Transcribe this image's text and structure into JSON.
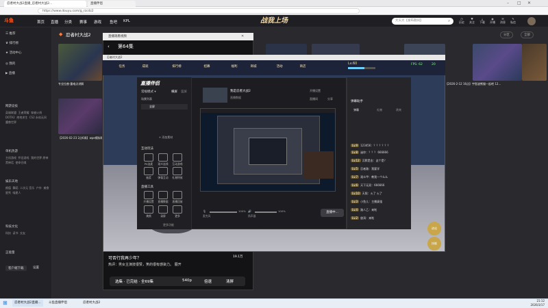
{
  "browser": {
    "tabs": [
      {
        "label": "忍者村大战2直播_忍者村大战2..."
      },
      {
        "label": "直播伴侣"
      }
    ],
    "url": "https://www.douyu.com/g_rzcdz2"
  },
  "site": {
    "logo": "斗鱼",
    "nav": [
      "首页",
      "直播",
      "分类",
      "赛事",
      "游戏",
      "鱼吧",
      "KPL"
    ],
    "banner_title": "战我上场",
    "search_placeholder": "大头大【发布期间】",
    "header_icons": [
      "历史",
      "关注",
      "下载",
      "开播",
      "消息",
      "私信"
    ]
  },
  "sidebar": {
    "items": [
      {
        "label": "推荐"
      },
      {
        "label": "排行榜"
      },
      {
        "label": "活动中心"
      },
      {
        "label": "我的"
      },
      {
        "label": "直播"
      }
    ],
    "sections": [
      {
        "title": "网游竞技",
        "subs": [
          "英雄联盟",
          "王者荣耀",
          "穿越火线",
          "DOTA2",
          "绝地求生",
          "CS2",
          "永劫无间",
          "魔兽世界"
        ]
      },
      {
        "title": "单机热游",
        "subs": [
          "主机游戏",
          "怀旧游戏",
          "我的世界",
          "原神",
          "黑神话",
          "使命召唤"
        ]
      },
      {
        "title": "娱乐天地",
        "subs": [
          "颜值",
          "舞蹈",
          "二次元",
          "音乐",
          "户外",
          "美食",
          "星秀",
          "喵星人"
        ]
      },
      {
        "title": "科技文化",
        "subs": [
          "科技",
          "读书",
          "交友"
        ]
      },
      {
        "title": "正能量",
        "subs": []
      }
    ],
    "bottom_buttons": [
      "客户端下载",
      "设置"
    ]
  },
  "main": {
    "heading": "忍者村大战2",
    "thumb_captions": [
      "【2026-2-12 16点】宇智波熊猫一起吧 12...",
      "【2026-02-23 2点6周】wpe模拟嗯嗯"
    ],
    "follow_button": "全部",
    "category_button": "分区"
  },
  "video_window": {
    "title": "直播观看视频",
    "episode": "第64集",
    "subtitle_line": "可否行我再少年？",
    "danmaku_line": "热评：男女主演技很赞，笑的很有感染力。",
    "expand": "展开",
    "views": "19.1万",
    "episode_bar": {
      "label": "选集 · 已完结 · 全69集",
      "quality": "540p",
      "speed": "倍速",
      "clear": "清屏"
    }
  },
  "game_window": {
    "title": "忍者村大战2",
    "menu": [
      "任务",
      "成就",
      "排行榜",
      "招募",
      "福利",
      "商城",
      "活动",
      "商店"
    ],
    "level": "Lv.60",
    "fps": "FPS: 62",
    "ping": "20",
    "bottom_labels": [
      "进化",
      "技能"
    ]
  },
  "companion": {
    "logo": "直播伴侣",
    "scene_select": "常规模式",
    "scene_tabs": [
      "横屏",
      "竖屏"
    ],
    "scene_list_label": "场景列表",
    "scene_name": "全屏",
    "add_source": "+ 添加素材",
    "sections": [
      {
        "title": "互动玩法",
        "items": [
          "PK连麦",
          "观众连线",
          "互动游戏",
          "抽奖",
          "弹幕互动",
          "礼物特效",
          "福袋",
          "红包"
        ]
      },
      {
        "title": "直播工具",
        "items": [
          "开播设置",
          "直播数据",
          "直播回放",
          "画质设置",
          "直播间管理",
          "美颜",
          "录屏",
          "更多"
        ]
      }
    ],
    "more_tools": "更多功能",
    "stream_title": "我是忍者大战2",
    "stream_subtitle": "直播数据",
    "toolbar_labels": [
      "开播设置",
      "直播间",
      "分享"
    ],
    "status": {
      "left_label": "麦克风",
      "right_label": "扬声器",
      "left_pct": "100%",
      "right_pct": "100%"
    },
    "start_button": "直播中..."
  },
  "chat": {
    "title": "弹幕助手",
    "tabs": [
      "弹幕",
      "礼物",
      "贵宾"
    ],
    "lines": [
      {
        "lvl": "Lv.9",
        "text": "123456：？？？？？？"
      },
      {
        "lvl": "Lv.8",
        "text": "迷你：？？？ 666666"
      },
      {
        "lvl": "Lv.12",
        "text": "沉默是金：这个是？"
      },
      {
        "lvl": "Lv.5",
        "text": "忍者路：我要学"
      },
      {
        "lvl": "Lv.7",
        "text": "观众甲：教我一个么么"
      },
      {
        "lvl": "Lv.6",
        "text": "天下无双：666666"
      },
      {
        "lvl": "Lv.10",
        "text": "天照：火了 火了"
      },
      {
        "lvl": "Lv.3",
        "text": "小鱼儿：主播真强"
      },
      {
        "lvl": "Lv.4",
        "text": "路人乙：来啦"
      },
      {
        "lvl": "Lv.2",
        "text": "旋涡：来啦"
      }
    ]
  },
  "taskbar": {
    "apps": [
      "忍者村大战2直播...",
      "斗鱼直播伴侣",
      "忍者村大战2"
    ],
    "time": "21:12",
    "date": "2026/3/17"
  }
}
